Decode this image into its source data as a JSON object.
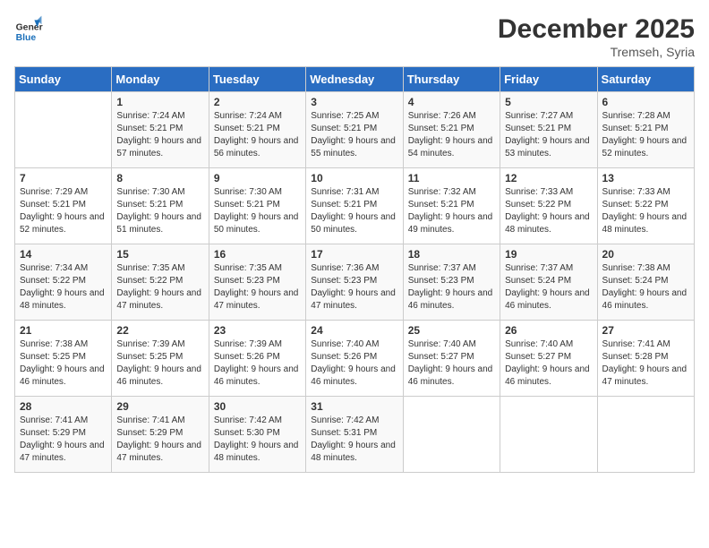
{
  "header": {
    "logo_line1": "General",
    "logo_line2": "Blue",
    "month_year": "December 2025",
    "location": "Tremseh, Syria"
  },
  "days_of_week": [
    "Sunday",
    "Monday",
    "Tuesday",
    "Wednesday",
    "Thursday",
    "Friday",
    "Saturday"
  ],
  "weeks": [
    [
      {
        "day": "",
        "sunrise": "",
        "sunset": "",
        "daylight": ""
      },
      {
        "day": "1",
        "sunrise": "7:24 AM",
        "sunset": "5:21 PM",
        "daylight": "9 hours and 57 minutes."
      },
      {
        "day": "2",
        "sunrise": "7:24 AM",
        "sunset": "5:21 PM",
        "daylight": "9 hours and 56 minutes."
      },
      {
        "day": "3",
        "sunrise": "7:25 AM",
        "sunset": "5:21 PM",
        "daylight": "9 hours and 55 minutes."
      },
      {
        "day": "4",
        "sunrise": "7:26 AM",
        "sunset": "5:21 PM",
        "daylight": "9 hours and 54 minutes."
      },
      {
        "day": "5",
        "sunrise": "7:27 AM",
        "sunset": "5:21 PM",
        "daylight": "9 hours and 53 minutes."
      },
      {
        "day": "6",
        "sunrise": "7:28 AM",
        "sunset": "5:21 PM",
        "daylight": "9 hours and 52 minutes."
      }
    ],
    [
      {
        "day": "7",
        "sunrise": "7:29 AM",
        "sunset": "5:21 PM",
        "daylight": "9 hours and 52 minutes."
      },
      {
        "day": "8",
        "sunrise": "7:30 AM",
        "sunset": "5:21 PM",
        "daylight": "9 hours and 51 minutes."
      },
      {
        "day": "9",
        "sunrise": "7:30 AM",
        "sunset": "5:21 PM",
        "daylight": "9 hours and 50 minutes."
      },
      {
        "day": "10",
        "sunrise": "7:31 AM",
        "sunset": "5:21 PM",
        "daylight": "9 hours and 50 minutes."
      },
      {
        "day": "11",
        "sunrise": "7:32 AM",
        "sunset": "5:21 PM",
        "daylight": "9 hours and 49 minutes."
      },
      {
        "day": "12",
        "sunrise": "7:33 AM",
        "sunset": "5:22 PM",
        "daylight": "9 hours and 48 minutes."
      },
      {
        "day": "13",
        "sunrise": "7:33 AM",
        "sunset": "5:22 PM",
        "daylight": "9 hours and 48 minutes."
      }
    ],
    [
      {
        "day": "14",
        "sunrise": "7:34 AM",
        "sunset": "5:22 PM",
        "daylight": "9 hours and 48 minutes."
      },
      {
        "day": "15",
        "sunrise": "7:35 AM",
        "sunset": "5:22 PM",
        "daylight": "9 hours and 47 minutes."
      },
      {
        "day": "16",
        "sunrise": "7:35 AM",
        "sunset": "5:23 PM",
        "daylight": "9 hours and 47 minutes."
      },
      {
        "day": "17",
        "sunrise": "7:36 AM",
        "sunset": "5:23 PM",
        "daylight": "9 hours and 47 minutes."
      },
      {
        "day": "18",
        "sunrise": "7:37 AM",
        "sunset": "5:23 PM",
        "daylight": "9 hours and 46 minutes."
      },
      {
        "day": "19",
        "sunrise": "7:37 AM",
        "sunset": "5:24 PM",
        "daylight": "9 hours and 46 minutes."
      },
      {
        "day": "20",
        "sunrise": "7:38 AM",
        "sunset": "5:24 PM",
        "daylight": "9 hours and 46 minutes."
      }
    ],
    [
      {
        "day": "21",
        "sunrise": "7:38 AM",
        "sunset": "5:25 PM",
        "daylight": "9 hours and 46 minutes."
      },
      {
        "day": "22",
        "sunrise": "7:39 AM",
        "sunset": "5:25 PM",
        "daylight": "9 hours and 46 minutes."
      },
      {
        "day": "23",
        "sunrise": "7:39 AM",
        "sunset": "5:26 PM",
        "daylight": "9 hours and 46 minutes."
      },
      {
        "day": "24",
        "sunrise": "7:40 AM",
        "sunset": "5:26 PM",
        "daylight": "9 hours and 46 minutes."
      },
      {
        "day": "25",
        "sunrise": "7:40 AM",
        "sunset": "5:27 PM",
        "daylight": "9 hours and 46 minutes."
      },
      {
        "day": "26",
        "sunrise": "7:40 AM",
        "sunset": "5:27 PM",
        "daylight": "9 hours and 46 minutes."
      },
      {
        "day": "27",
        "sunrise": "7:41 AM",
        "sunset": "5:28 PM",
        "daylight": "9 hours and 47 minutes."
      }
    ],
    [
      {
        "day": "28",
        "sunrise": "7:41 AM",
        "sunset": "5:29 PM",
        "daylight": "9 hours and 47 minutes."
      },
      {
        "day": "29",
        "sunrise": "7:41 AM",
        "sunset": "5:29 PM",
        "daylight": "9 hours and 47 minutes."
      },
      {
        "day": "30",
        "sunrise": "7:42 AM",
        "sunset": "5:30 PM",
        "daylight": "9 hours and 48 minutes."
      },
      {
        "day": "31",
        "sunrise": "7:42 AM",
        "sunset": "5:31 PM",
        "daylight": "9 hours and 48 minutes."
      },
      {
        "day": "",
        "sunrise": "",
        "sunset": "",
        "daylight": ""
      },
      {
        "day": "",
        "sunrise": "",
        "sunset": "",
        "daylight": ""
      },
      {
        "day": "",
        "sunrise": "",
        "sunset": "",
        "daylight": ""
      }
    ]
  ]
}
